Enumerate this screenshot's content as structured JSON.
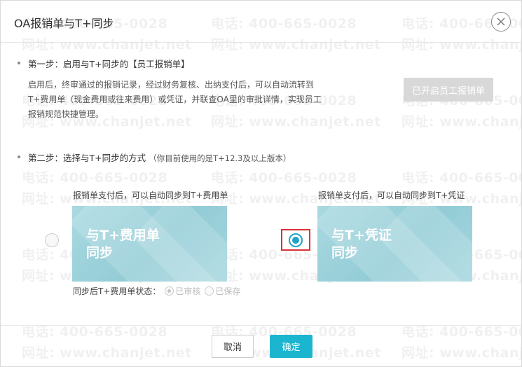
{
  "dialog": {
    "title": "OA报销单与T+同步",
    "close_icon": "close-icon"
  },
  "watermark": {
    "phone": "电话: 400-665-0028",
    "site": "网址: www.chanjet.net"
  },
  "step1": {
    "label": "第一步：启用与T+同步的【员工报销单】",
    "description": "启用后，终审通过的报销记录，经过财务复核、出纳支付后，可以自动流转到T+费用单（现金费用或往来费用）或凭证，并联查OA里的审批详情，实现员工报销规范快捷管理。",
    "enabled_button": "已开启员工报销单"
  },
  "step2": {
    "label": "第二步：选择与T+同步的方式",
    "note": "（你目前使用的是T+12.3及以上版本）"
  },
  "options": [
    {
      "caption": "报销单支付后，可以自动同步到T+费用单",
      "card_line1": "与T+费用单",
      "card_line2": "同步",
      "selected": false
    },
    {
      "caption": "报销单支付后，可以自动同步到T+凭证",
      "card_line1": "与T+凭证",
      "card_line2": "同步",
      "selected": true
    }
  ],
  "status": {
    "label": "同步后T+费用单状态：",
    "opt1": "已审核",
    "opt2": "已保存",
    "selected": "已审核"
  },
  "footer": {
    "cancel": "取消",
    "ok": "确定"
  },
  "colors": {
    "accent": "#1bb5cf",
    "radio": "#1fa3c8",
    "highlight": "#d9333a",
    "card": "#9fd3dc"
  }
}
